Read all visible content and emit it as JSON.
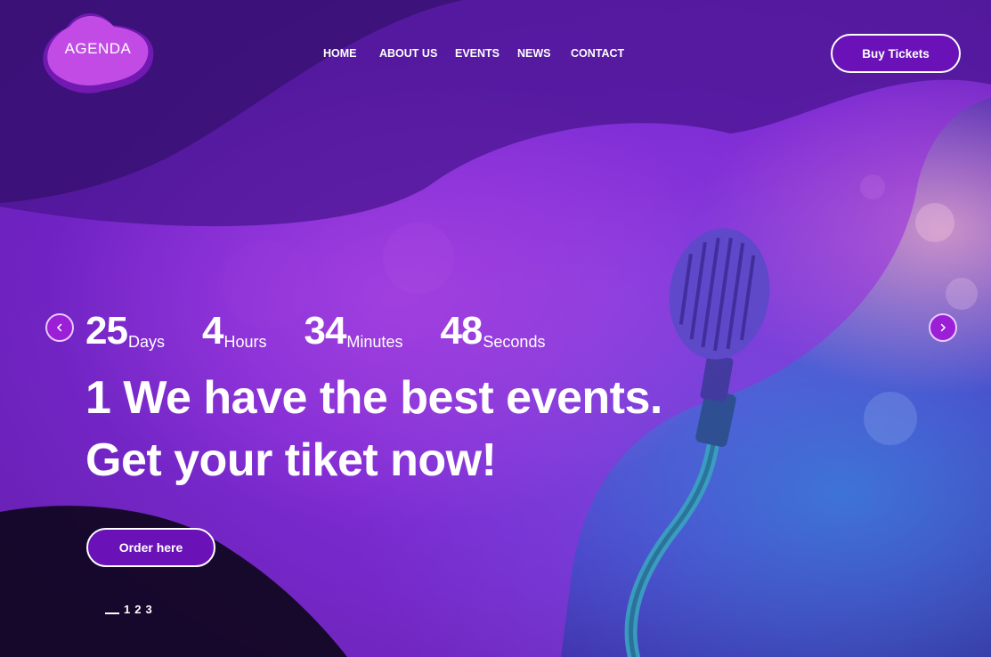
{
  "brand": {
    "logo_text": "AGENDA"
  },
  "nav": {
    "items": [
      {
        "label": "HOME"
      },
      {
        "label": "ABOUT US"
      },
      {
        "label": "EVENTS"
      },
      {
        "label": "NEWS"
      },
      {
        "label": "CONTACT"
      }
    ]
  },
  "header": {
    "buy_label": "Buy Tickets"
  },
  "slider": {
    "prev_icon": "chevron-left-icon",
    "next_icon": "chevron-right-icon",
    "pages": [
      "1",
      "2",
      "3"
    ]
  },
  "countdown": {
    "days": {
      "value": "25",
      "label": "Days"
    },
    "hours": {
      "value": "4",
      "label": "Hours"
    },
    "minutes": {
      "value": "34",
      "label": "Minutes"
    },
    "seconds": {
      "value": "48",
      "label": "Seconds"
    }
  },
  "hero": {
    "line1": "1 We have the best events.",
    "line2": "Get your tiket now!",
    "order_label": "Order here"
  },
  "colors": {
    "accent": "#9b1fd6",
    "button_fill": "#6a12b8",
    "background": "#2a0f5a"
  }
}
